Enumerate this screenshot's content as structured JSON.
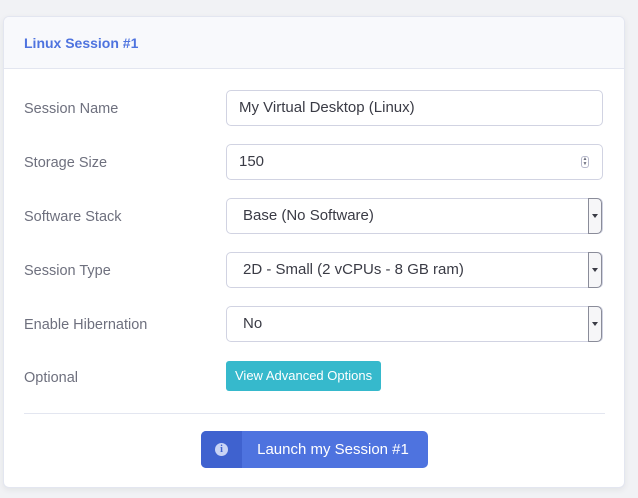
{
  "card": {
    "title": "Linux Session #1"
  },
  "form": {
    "session_name": {
      "label": "Session Name",
      "value": "My Virtual Desktop (Linux)"
    },
    "storage_size": {
      "label": "Storage Size",
      "value": "150"
    },
    "software_stack": {
      "label": "Software Stack",
      "selected": "Base (No Software)"
    },
    "session_type": {
      "label": "Session Type",
      "selected": "2D - Small (2 vCPUs - 8 GB ram)"
    },
    "hibernation": {
      "label": "Enable Hibernation",
      "selected": "No"
    },
    "optional": {
      "label": "Optional",
      "button_label": "View Advanced Options"
    }
  },
  "launch": {
    "label": "Launch my Session #1",
    "icon": "info-icon"
  },
  "colors": {
    "primary": "#4e73df",
    "info": "#36b9cc",
    "header_bg": "#f8f9fc",
    "border": "#e3e6f0"
  }
}
